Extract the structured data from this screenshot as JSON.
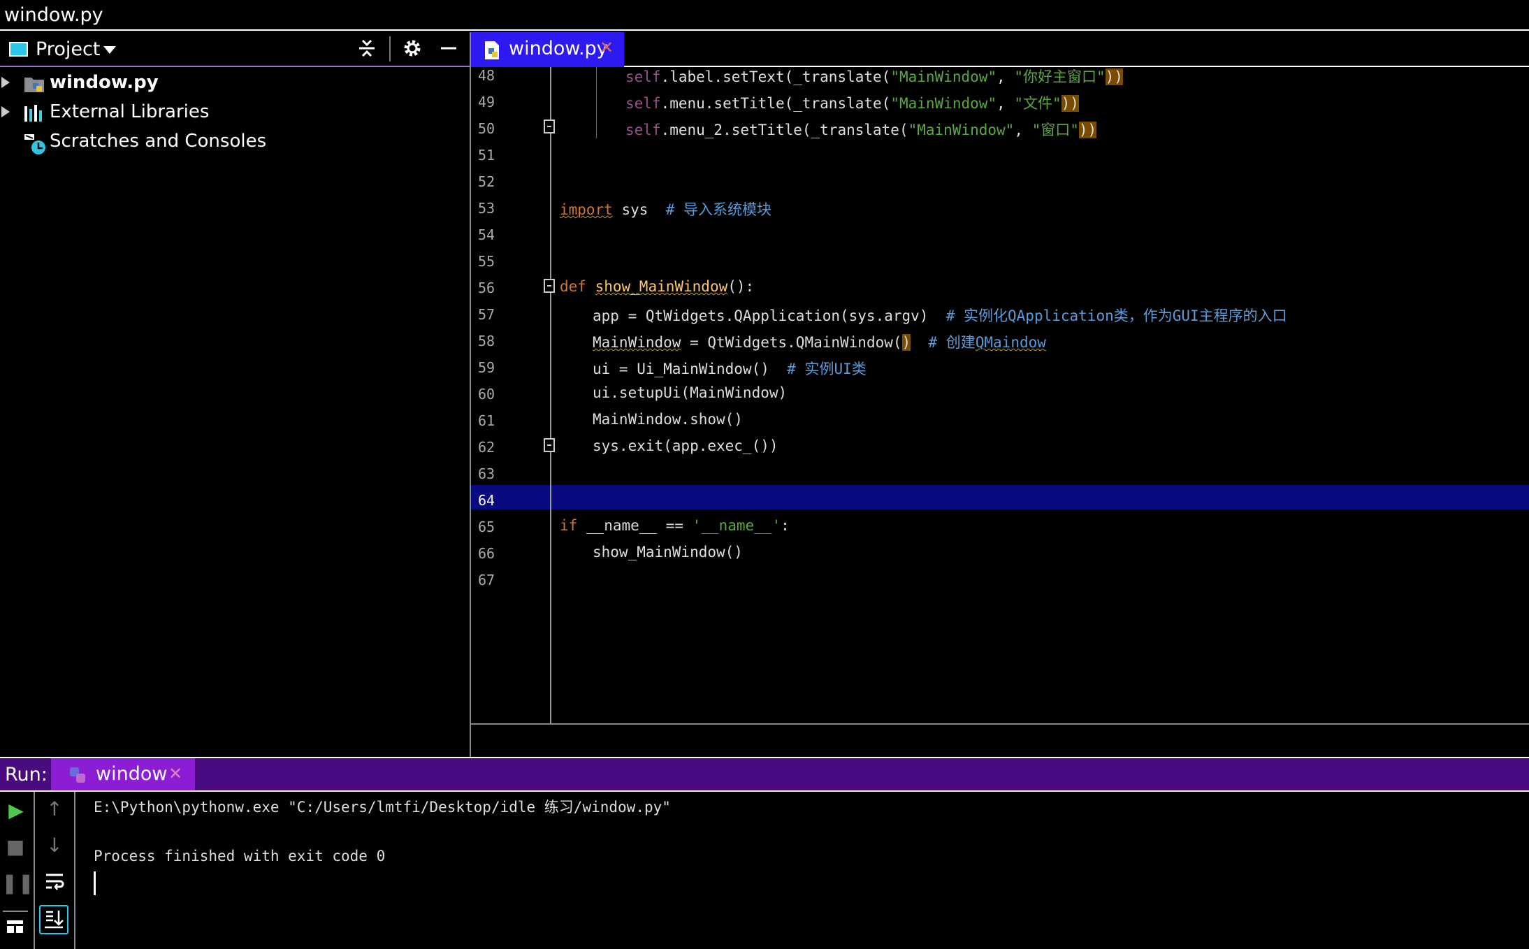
{
  "window": {
    "title": "window.py"
  },
  "project_panel": {
    "title": "Project",
    "items": [
      {
        "label": "window.py",
        "bold": true
      },
      {
        "label": "External Libraries"
      },
      {
        "label": "Scratches and Consoles"
      }
    ]
  },
  "editor": {
    "tab_label": "window.py",
    "current_line": "64",
    "lines": [
      {
        "no": "48"
      },
      {
        "no": "49"
      },
      {
        "no": "50"
      },
      {
        "no": "51"
      },
      {
        "no": "52"
      },
      {
        "no": "53"
      },
      {
        "no": "54"
      },
      {
        "no": "55"
      },
      {
        "no": "56"
      },
      {
        "no": "57"
      },
      {
        "no": "58"
      },
      {
        "no": "59"
      },
      {
        "no": "60"
      },
      {
        "no": "61"
      },
      {
        "no": "62"
      },
      {
        "no": "63"
      },
      {
        "no": "64"
      },
      {
        "no": "65"
      },
      {
        "no": "66"
      },
      {
        "no": "67"
      }
    ],
    "code": {
      "l48": {
        "self": "self",
        "rest": ".label.setText(_translate(",
        "s1": "\"MainWindow\"",
        "comma": ", ",
        "s2": "\"你好主窗口\"",
        "close": "))"
      },
      "l49": {
        "self": "self",
        "rest": ".menu.setTitle(_translate(",
        "s1": "\"MainWindow\"",
        "comma": ", ",
        "s2": "\"文件\"",
        "close": "))"
      },
      "l50": {
        "self": "self",
        "rest": ".menu_2.setTitle(_translate(",
        "s1": "\"MainWindow\"",
        "comma": ", ",
        "s2": "\"窗口\"",
        "close": "))"
      },
      "l53": {
        "kw": "import",
        "rest": " sys  ",
        "comment": "# 导入系统模块"
      },
      "l56": {
        "kw": "def",
        "fn": "show_MainWindow",
        "rest": "():"
      },
      "l57": {
        "code": "app = QtWidgets.QApplication(sys.argv)  ",
        "comment": "# 实例化QApplication类，作为GUI主程序的入口"
      },
      "l58": {
        "var": "MainWindow",
        "code": " = QtWidgets.QMainWindow(",
        "close": ")",
        "comment_pre": "  # 创建",
        "comment_sq": "QMaindow"
      },
      "l59": {
        "code": "ui = Ui_MainWindow()  ",
        "comment": "# 实例UI类"
      },
      "l60": {
        "code": "ui.setupUi(MainWindow)"
      },
      "l61": {
        "code": "MainWindow.show()"
      },
      "l62": {
        "code": "sys.exit(app.exec_())"
      },
      "l65": {
        "kw": "if",
        "code": " __name__ == ",
        "str": "'__name__'",
        "end": ":"
      },
      "l66": {
        "code": "show_MainWindow()"
      }
    }
  },
  "run": {
    "label": "Run:",
    "tab_label": "window",
    "console": [
      "E:\\Python\\pythonw.exe \"C:/Users/lmtfi/Desktop/idle 练习/window.py\"",
      "",
      "Process finished with exit code 0"
    ]
  },
  "colors": {
    "tab_active": "#2c1af0",
    "run_bar": "#4a0a80",
    "run_tab": "#8b1ed4",
    "current_line": "#0a0a80",
    "keyword": "#cc7832",
    "string": "#5ba840",
    "comment": "#5a9bd8"
  }
}
